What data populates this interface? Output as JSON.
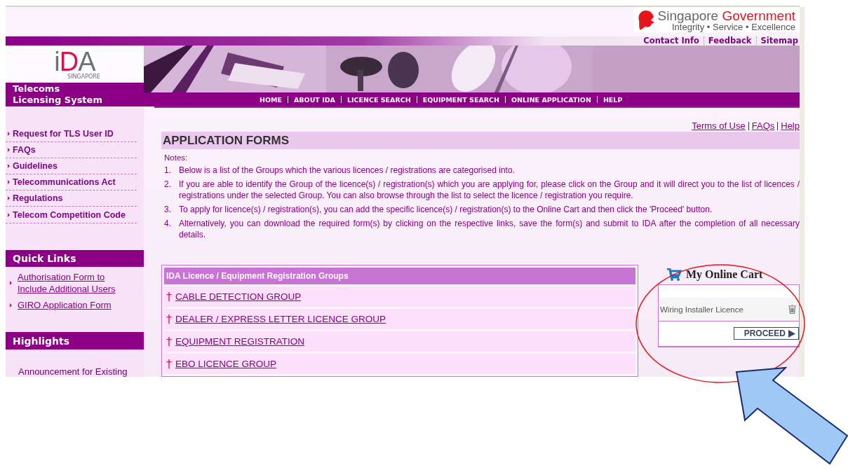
{
  "gov_logo": {
    "name": "Singapore",
    "highlight": "Government",
    "tagline": "Integrity • Service • Excellence"
  },
  "top_links": [
    "Contact Info",
    "Feedback",
    "Sitemap"
  ],
  "brand": {
    "logo_parts": [
      {
        "text": "i",
        "accent": false
      },
      {
        "text": "D",
        "accent": true
      },
      {
        "text": "A",
        "accent": false
      }
    ],
    "logo_sub": "SINGAPORE",
    "system": "Telecoms\nLicensing System"
  },
  "nav": [
    "HOME",
    "ABOUT IDA",
    "LICENCE SEARCH",
    "EQUIPMENT SEARCH",
    "ONLINE APPLICATION",
    "HELP"
  ],
  "sidebar": {
    "menu": [
      "Request for TLS User ID",
      "FAQs",
      "Guidelines",
      "Telecommunications Act",
      "Regulations",
      "Telecom Competition Code"
    ],
    "quick_links": {
      "title": "Quick Links",
      "items": [
        "Authorisation Form to Include Additional Users",
        "GIRO Application Form"
      ]
    },
    "highlights": {
      "title": "Highlights",
      "items": [
        "Announcement for Existing"
      ]
    }
  },
  "utility_links": [
    "Terms of Use",
    "FAQs",
    "Help"
  ],
  "heading": "APPLICATION FORMS",
  "notes": {
    "label": "Notes:",
    "items": [
      {
        "number": "1.",
        "text": "Below is a list of the Groups which the various licences / registrations are categorised into."
      },
      {
        "number": "2.",
        "text": "If you are able to identify the Group of the licence(s) / registration(s) which you are applying for, please click on the Group and it will direct you to the list of licences / registrations under the selected Group. You can also browse through the list to select the licence / registration you require."
      },
      {
        "number": "3.",
        "text": "To apply for licence(s) / registration(s), you can add the specific licence(s) / registration(s) to the Online Cart and then click the 'Proceed' button."
      },
      {
        "number": "4.",
        "text": "Alternatively, you can download the required form(s) by clicking on the respective links, save the form(s) and submit to IDA after the completion of all necessary details."
      }
    ]
  },
  "groups": {
    "title": "IDA Licence / Equipment Registration Groups",
    "rows": [
      {
        "mark": "†",
        "label": "CABLE DETECTION GROUP"
      },
      {
        "mark": "†",
        "label": "DEALER / EXPRESS LETTER LICENCE GROUP"
      },
      {
        "mark": "†",
        "label": "EQUIPMENT REGISTRATION"
      },
      {
        "mark": "†",
        "label": "EBO LICENCE GROUP"
      }
    ]
  },
  "cart": {
    "title": "My Online Cart",
    "items": [
      {
        "name": "Wiring Installer Licence"
      }
    ],
    "button": "PROCEED"
  }
}
